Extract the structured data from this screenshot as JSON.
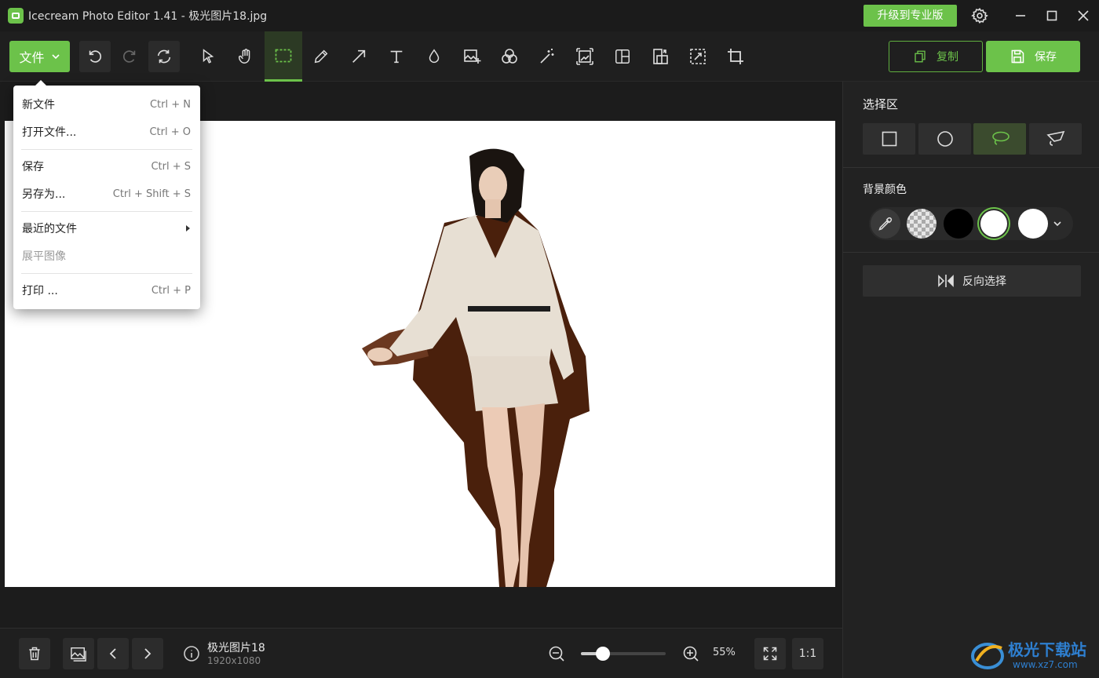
{
  "titlebar": {
    "title": "Icecream Photo Editor 1.41 - 极光图片18.jpg",
    "upgrade_label": "升级到专业版"
  },
  "toolbar": {
    "file_label": "文件",
    "copy_label": "复制",
    "save_label": "保存",
    "tools": [
      "cursor-icon",
      "hand-icon",
      "rect-select-icon",
      "pencil-icon",
      "arrow-icon",
      "text-icon",
      "drop-icon",
      "add-image-icon",
      "filters-icon",
      "magic-wand-icon",
      "resize-icon",
      "collage-icon",
      "rotate-icon",
      "crop-resize-icon",
      "crop-icon"
    ],
    "active_tool": "rect-select-icon"
  },
  "file_menu": {
    "items": [
      {
        "label": "新文件",
        "shortcut": "Ctrl + N"
      },
      {
        "label": "打开文件...",
        "shortcut": "Ctrl + O"
      },
      {
        "label": "保存",
        "shortcut": "Ctrl + S"
      },
      {
        "label": "另存为...",
        "shortcut": "Ctrl + Shift + S"
      },
      {
        "label": "最近的文件",
        "shortcut": ""
      },
      {
        "label": "展平图像",
        "shortcut": "",
        "disabled": true
      },
      {
        "label": "打印 ...",
        "shortcut": "Ctrl + P"
      }
    ]
  },
  "right_panel": {
    "selection_title": "选择区",
    "selection_modes": [
      "rectangle-icon",
      "circle-icon",
      "lasso-icon",
      "polygon-lasso-icon"
    ],
    "active_mode": "lasso-icon",
    "bg_color_title": "背景颜色",
    "bg_colors": [
      "eyedropper",
      "transparent",
      "#000000",
      "#ffffff",
      "#ffffff"
    ],
    "selected_color": "#ffffff",
    "invert_label": "反向选择"
  },
  "bottombar": {
    "file_name": "极光图片18",
    "file_dims": "1920x1080",
    "zoom_label": "55%",
    "zoom_fraction": 0.26,
    "actual_size_label": "1:1"
  },
  "watermark": {
    "text": "极光下载站",
    "url": "www.xz7.com"
  },
  "colors": {
    "accent": "#6cc24a",
    "background": "#1c1c1c",
    "panel": "#222222"
  }
}
